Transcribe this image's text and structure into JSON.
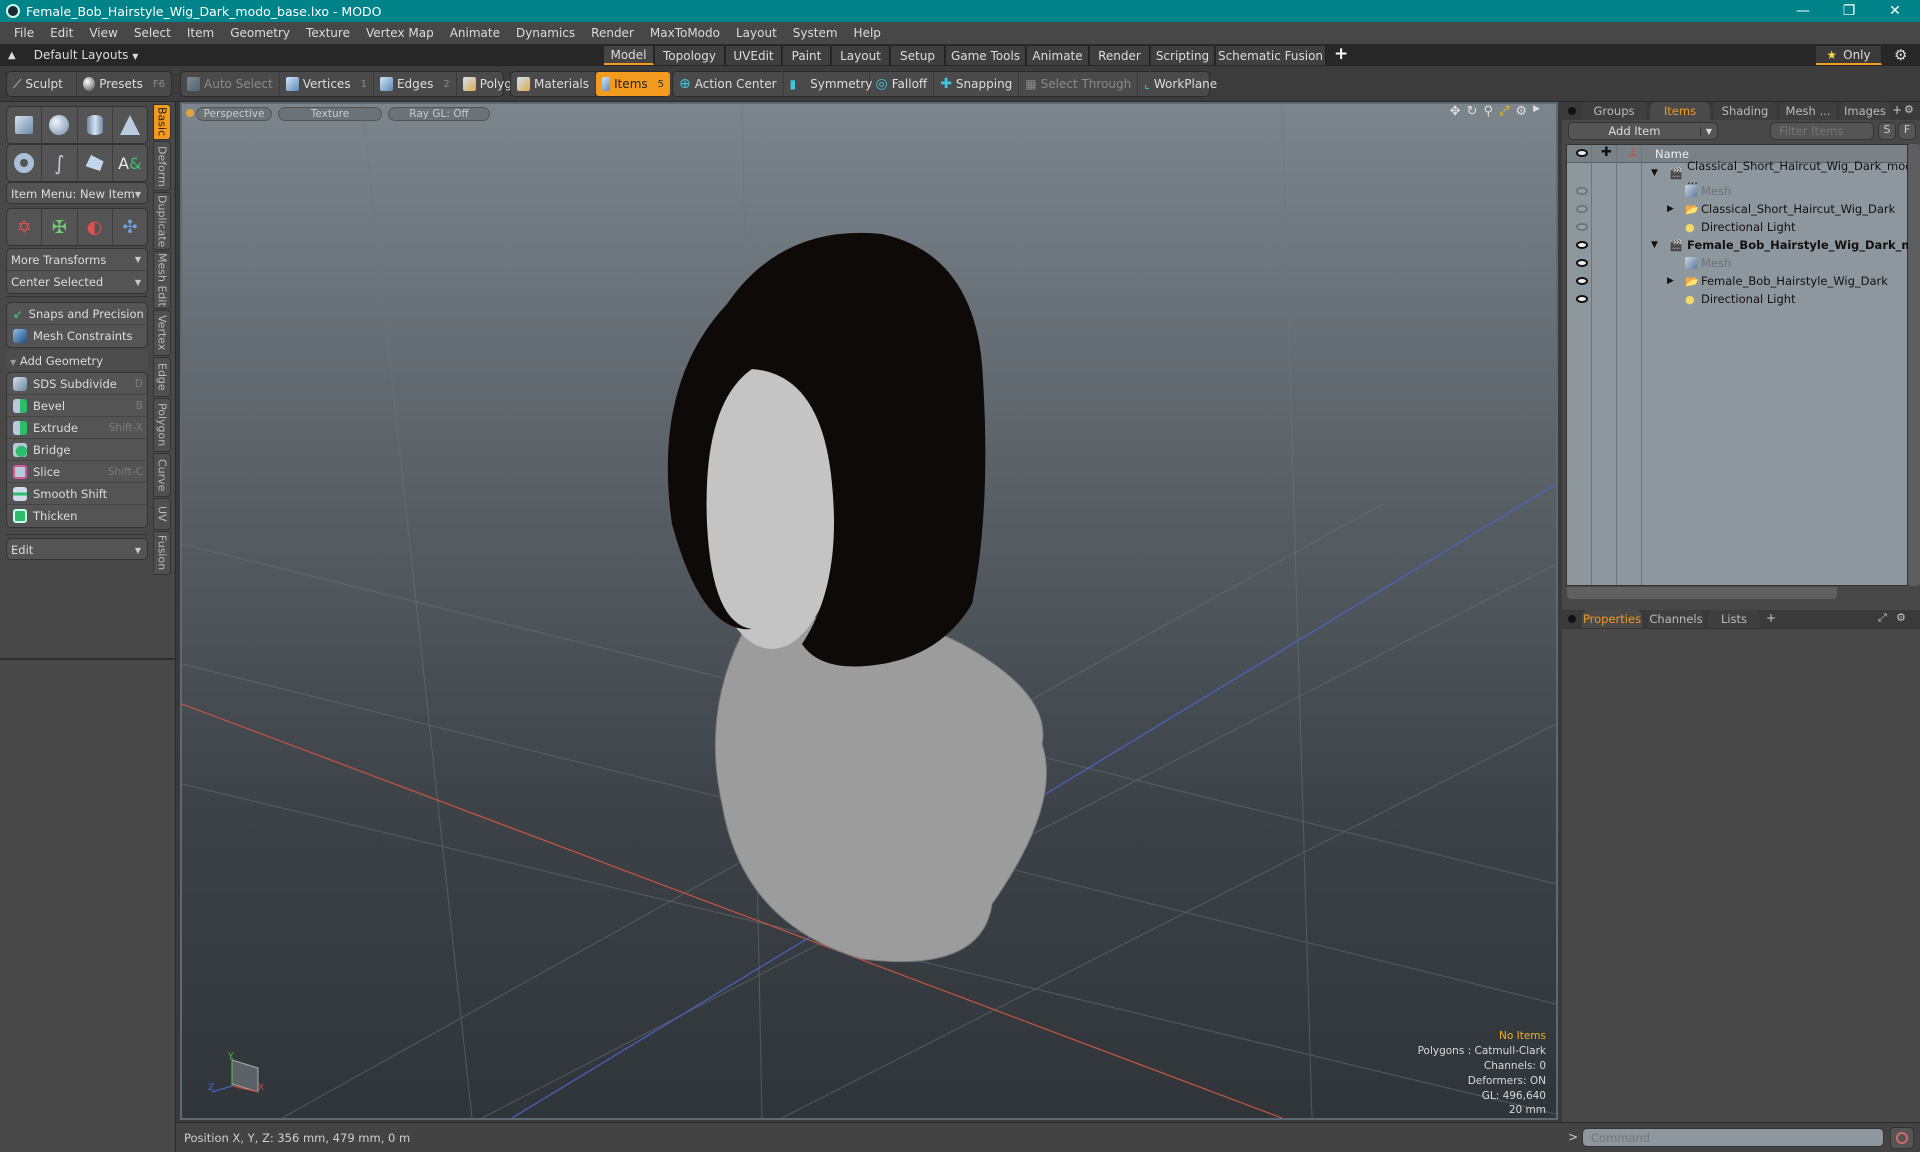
{
  "window": {
    "title": "Female_Bob_Hairstyle_Wig_Dark_modo_base.lxo - MODO",
    "controls": [
      "minimize",
      "restore",
      "close"
    ]
  },
  "menubar": [
    "File",
    "Edit",
    "View",
    "Select",
    "Item",
    "Geometry",
    "Texture",
    "Vertex Map",
    "Animate",
    "Dynamics",
    "Render",
    "MaxToModo",
    "Layout",
    "System",
    "Help"
  ],
  "layoutbar": {
    "layouts_label": "Default Layouts",
    "tabs": [
      "Model",
      "Topology",
      "UVEdit",
      "Paint",
      "Layout",
      "Setup",
      "Game Tools",
      "Animate",
      "Render",
      "Scripting",
      "Schematic Fusion"
    ],
    "active_tab": "Model",
    "add_tab": "+",
    "only_label": "Only"
  },
  "toolbar": {
    "sculpt": "Sculpt",
    "presets": "Presets",
    "presets_key": "F6",
    "auto_select": "Auto Select",
    "vertices": "Vertices",
    "vertices_key": "1",
    "edges": "Edges",
    "edges_key": "2",
    "polygons": "Polygons",
    "materials": "Materials",
    "items": "Items",
    "items_key": "5",
    "action_center": "Action Center",
    "symmetry": "Symmetry",
    "falloff": "Falloff",
    "snapping": "Snapping",
    "select_through": "Select Through",
    "workplane": "WorkPlane"
  },
  "leftpanel": {
    "item_menu": "Item Menu: New Item",
    "more_transforms": "More Transforms",
    "center_selected": "Center Selected",
    "snaps": "Snaps and Precision",
    "mesh_constraints": "Mesh Constraints",
    "add_geometry": "Add Geometry",
    "tools": [
      {
        "label": "SDS Subdivide",
        "key": "D"
      },
      {
        "label": "Bevel",
        "key": "B"
      },
      {
        "label": "Extrude",
        "key": "Shift-X"
      },
      {
        "label": "Bridge",
        "key": ""
      },
      {
        "label": "Slice",
        "key": "Shift-C"
      },
      {
        "label": "Smooth Shift",
        "key": ""
      },
      {
        "label": "Thicken",
        "key": ""
      }
    ],
    "edit": "Edit",
    "vtabs": [
      "Basic",
      "Deform",
      "Duplicate",
      "Mesh Edit",
      "Vertex",
      "Edge",
      "Polygon",
      "Curve",
      "UV",
      "Fusion"
    ]
  },
  "viewport": {
    "tabs": [
      "Perspective",
      "Texture",
      "Ray GL: Off"
    ],
    "info": {
      "selection": "No Items",
      "polygons": "Polygons : Catmull-Clark",
      "channels": "Channels: 0",
      "deformers": "Deformers: ON",
      "gl": "GL: 496,640",
      "scale": "20 mm"
    },
    "axis_labels": {
      "x": "X",
      "y": "Y",
      "z": "Z"
    }
  },
  "statusbar": {
    "position": "Position X, Y, Z:   356 mm, 479 mm, 0 m"
  },
  "rightpanel": {
    "top_tabs": [
      "Groups",
      "Items",
      "Shading",
      "Mesh ...",
      "Images"
    ],
    "active_top_tab": "Items",
    "add_item": "Add Item",
    "filter_placeholder": "Filter Items",
    "s_btn": "S",
    "f_btn": "F",
    "column_name": "Name",
    "items": [
      {
        "label": "Classical_Short_Haircut_Wig_Dark_modo_ ...",
        "level": 0,
        "type": "scene",
        "bold": false,
        "eye": "none",
        "expander": "▼"
      },
      {
        "label": "Mesh",
        "level": 1,
        "type": "mesh",
        "dim": true,
        "eye": "dim",
        "expander": ""
      },
      {
        "label": "Classical_Short_Haircut_Wig_Dark",
        "level": 1,
        "type": "group",
        "eye": "dim",
        "expander": "▶"
      },
      {
        "label": "Directional Light",
        "level": 1,
        "type": "light",
        "eye": "dim",
        "expander": ""
      },
      {
        "label": "Female_Bob_Hairstyle_Wig_Dark_m...",
        "level": 0,
        "type": "scene",
        "bold": true,
        "eye": "on",
        "expander": "▼"
      },
      {
        "label": "Mesh",
        "level": 1,
        "type": "mesh",
        "dim": true,
        "eye": "on",
        "expander": ""
      },
      {
        "label": "Female_Bob_Hairstyle_Wig_Dark",
        "level": 1,
        "type": "group",
        "eye": "on",
        "expander": "▶"
      },
      {
        "label": "Directional Light",
        "level": 1,
        "type": "light",
        "eye": "on",
        "expander": ""
      }
    ],
    "bottom_tabs": [
      "Properties",
      "Channels",
      "Lists"
    ],
    "active_bottom_tab": "Properties",
    "command_placeholder": "Command"
  },
  "colors": {
    "accent": "#f29b1f",
    "titlebar": "#00848a"
  }
}
